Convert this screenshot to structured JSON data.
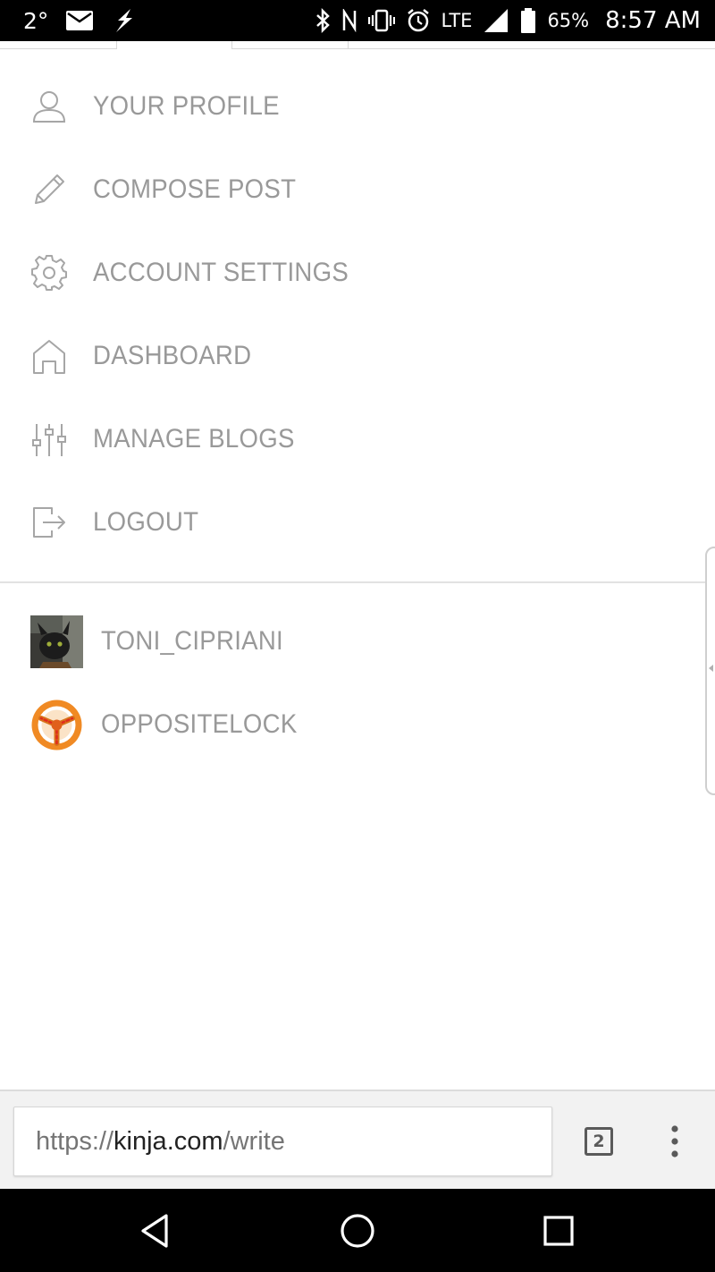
{
  "status_bar": {
    "temperature": "2°",
    "network": "LTE",
    "battery": "65%",
    "time": "8:57 AM",
    "icons": [
      "mail-icon",
      "flash-icon",
      "bluetooth-icon",
      "nfc-icon",
      "vibrate-icon",
      "alarm-icon",
      "signal-icon",
      "battery-icon"
    ]
  },
  "menu": {
    "items": [
      {
        "label": "YOUR PROFILE",
        "icon": "user-icon"
      },
      {
        "label": "COMPOSE POST",
        "icon": "pencil-icon"
      },
      {
        "label": "ACCOUNT SETTINGS",
        "icon": "gear-icon"
      },
      {
        "label": "DASHBOARD",
        "icon": "home-icon"
      },
      {
        "label": "MANAGE BLOGS",
        "icon": "sliders-icon"
      },
      {
        "label": "LOGOUT",
        "icon": "logout-icon"
      }
    ]
  },
  "blogs": [
    {
      "name": "TONI_CIPRIANI",
      "avatar": "dragon-avatar"
    },
    {
      "name": "OPPOSITELOCK",
      "avatar": "steering-wheel-avatar"
    }
  ],
  "url_bar": {
    "scheme": "https://",
    "domain": "kinja.com",
    "path": "/write",
    "tab_count": "2"
  },
  "colors": {
    "menu_text": "#999999",
    "icon_stroke": "#a6a6a6",
    "status_bar_bg": "#000000",
    "oppositelock_orange": "#f08a24"
  }
}
